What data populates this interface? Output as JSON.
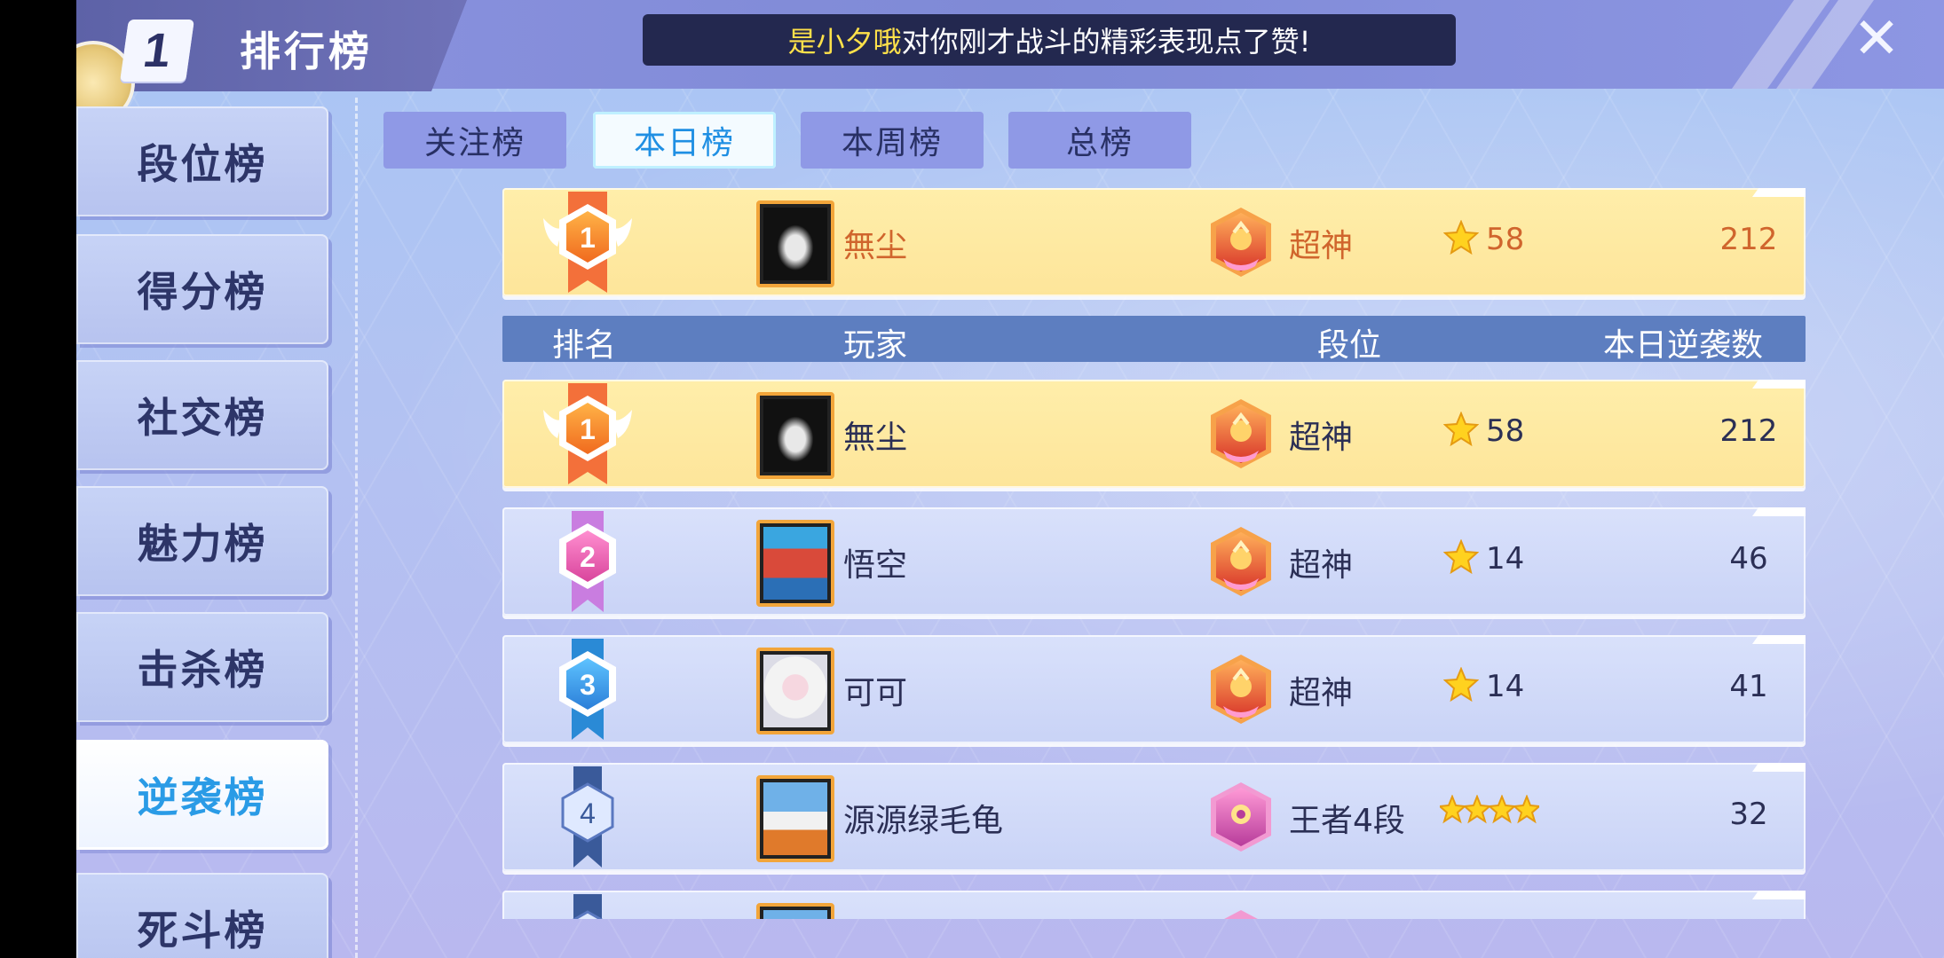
{
  "header": {
    "rank_number": "1",
    "title": "排行榜",
    "notice": {
      "name": "是小夕哦",
      "message": "对你刚才战斗的精彩表现点了赞!"
    },
    "close_icon": "close-icon"
  },
  "sidebar": {
    "items": [
      {
        "label": "段位榜",
        "active": false
      },
      {
        "label": "得分榜",
        "active": false
      },
      {
        "label": "社交榜",
        "active": false
      },
      {
        "label": "魅力榜",
        "active": false
      },
      {
        "label": "击杀榜",
        "active": false
      },
      {
        "label": "逆袭榜",
        "active": true
      },
      {
        "label": "死斗榜",
        "active": false
      }
    ]
  },
  "tabs": [
    {
      "label": "关注榜",
      "active": false
    },
    {
      "label": "本日榜",
      "active": true
    },
    {
      "label": "本周榜",
      "active": false
    },
    {
      "label": "总榜",
      "active": false
    }
  ],
  "my_row": {
    "rank": "1",
    "name": "無尘",
    "tier": "超神",
    "stars": "58",
    "value": "212"
  },
  "columns": {
    "rank": "排名",
    "player": "玩家",
    "tier": "段位",
    "value": "本日逆袭数"
  },
  "rows": [
    {
      "rank": "1",
      "name": "無尘",
      "tier": "超神",
      "stars": "58",
      "value": "212"
    },
    {
      "rank": "2",
      "name": "悟空",
      "tier": "超神",
      "stars": "14",
      "value": "46"
    },
    {
      "rank": "3",
      "name": "可可",
      "tier": "超神",
      "stars": "14",
      "value": "41"
    },
    {
      "rank": "4",
      "name": "源源绿毛龟",
      "tier": "王者4段",
      "stars": "4",
      "value": "32"
    }
  ],
  "colors": {
    "gold_row": "#fde59a",
    "blue_row": "#c9d3f6",
    "active_tab_text": "#1f8fe3",
    "highlight_name": "#ffe14a"
  }
}
